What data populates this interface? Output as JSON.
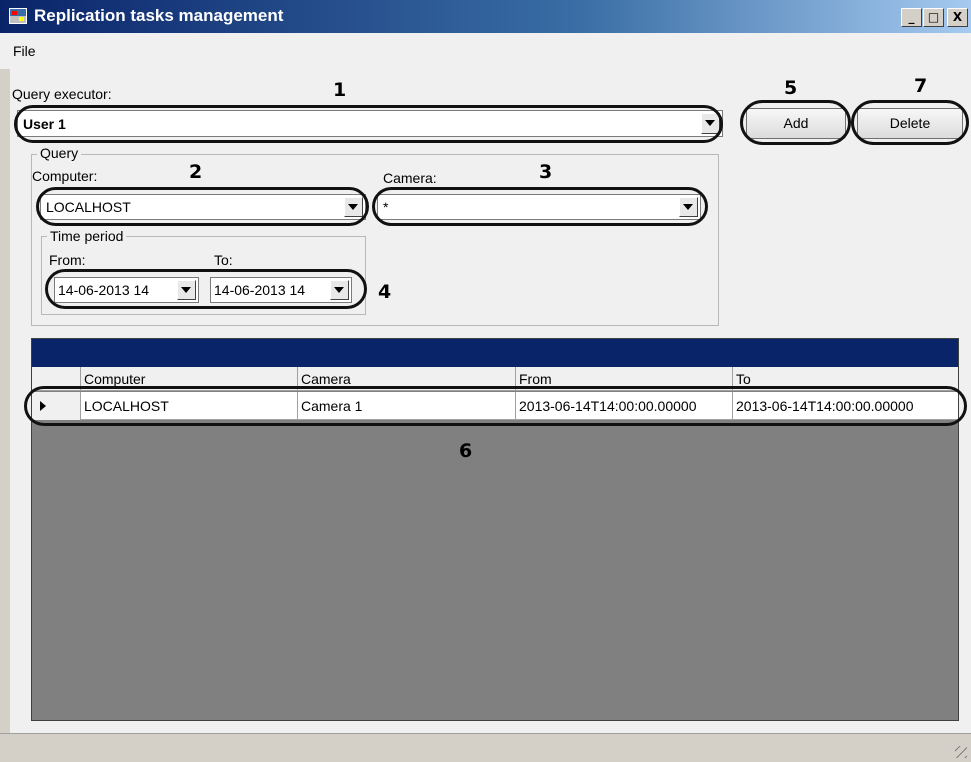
{
  "window": {
    "title": "Replication tasks management",
    "minimize": "_",
    "maximize": "□",
    "close": "X"
  },
  "menu": {
    "file": "File"
  },
  "executor": {
    "label": "Query executor:",
    "value": "User 1"
  },
  "buttons": {
    "add": "Add",
    "delete": "Delete"
  },
  "query": {
    "group_title": "Query",
    "computer_label": "Computer:",
    "computer_value": "LOCALHOST",
    "camera_label": "Camera:",
    "camera_value": "*",
    "time_group_title": "Time period",
    "from_label": "From:",
    "from_value": "14-06-2013 14",
    "to_label": "To:",
    "to_value": "14-06-2013 14"
  },
  "grid": {
    "columns": [
      "Computer",
      "Camera",
      "From",
      "To"
    ],
    "rows": [
      [
        "LOCALHOST",
        "Camera 1",
        "2013-06-14T14:00:00.00000",
        "2013-06-14T14:00:00.00000"
      ]
    ]
  },
  "annotations": [
    "1",
    "2",
    "3",
    "4",
    "5",
    "6",
    "7"
  ]
}
